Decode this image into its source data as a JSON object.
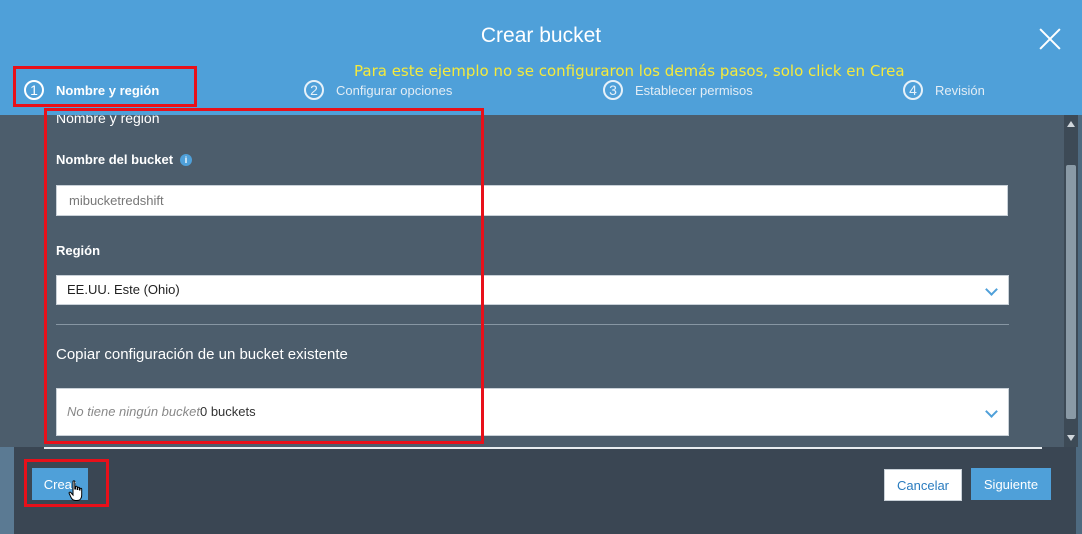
{
  "dialog": {
    "title": "Crear bucket"
  },
  "annotation": {
    "note": "Para este ejemplo no se configuraron los demás pasos, solo click en Crea"
  },
  "steps": [
    {
      "num": "1",
      "label": "Nombre y región"
    },
    {
      "num": "2",
      "label": "Configurar opciones"
    },
    {
      "num": "3",
      "label": "Establecer permisos"
    },
    {
      "num": "4",
      "label": "Revisión"
    }
  ],
  "form": {
    "section_heading": "Nombre y región",
    "bucket_name_label": "Nombre del bucket",
    "bucket_name_value": "mibucketredshift",
    "region_label": "Región",
    "region_value": "EE.UU. Este (Ohio)",
    "copy_heading": "Copiar configuración de un bucket existente",
    "copy_placeholder": "No tiene ningún bucket",
    "copy_count": "0 buckets"
  },
  "buttons": {
    "create": "Crear",
    "cancel": "Cancelar",
    "next": "Siguiente"
  },
  "icons": {
    "info": "i",
    "close": "close-icon",
    "chevron": "chevron-down-icon",
    "cursor": "hand-cursor-icon"
  },
  "colors": {
    "header": "#4fa0d9",
    "highlight": "#e8101a",
    "note": "#f6ea3b"
  }
}
